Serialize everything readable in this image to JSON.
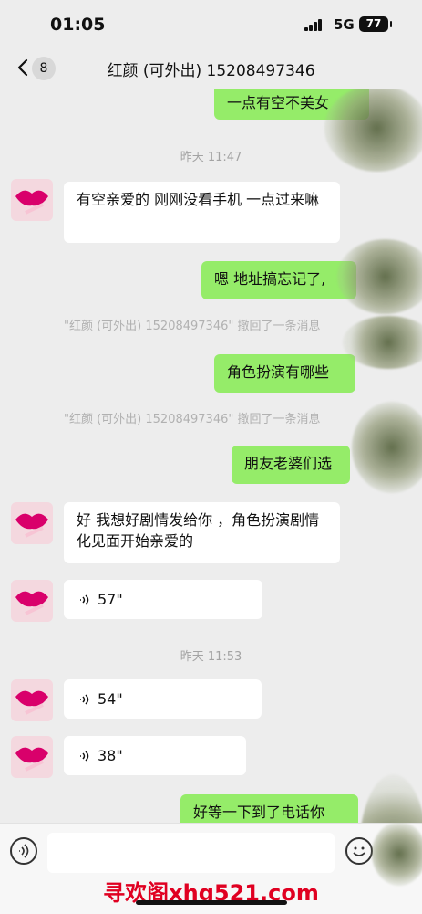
{
  "status_bar": {
    "time": "01:05",
    "network": "5G",
    "battery": "77"
  },
  "header": {
    "unread": "8",
    "title": "红颜 (可外出) 15208497346"
  },
  "messages": {
    "m1": "一点有空不美女",
    "t1": "昨天 11:47",
    "m2": "有空亲爱的  刚刚没看手机 一点过来嘛",
    "m3": "嗯 地址搞忘记了,",
    "s1": "\"红颜 (可外出) 15208497346\" 撤回了一条消息",
    "m4": "角色扮演有哪些",
    "s2": "\"红颜 (可外出) 15208497346\" 撤回了一条消息",
    "m5": "朋友老婆们选",
    "m6": "好 我想好剧情发给你 ，角色扮演剧情化见面开始亲爱的",
    "v1": "57\"",
    "t2": "昨天 11:53",
    "v2": "54\"",
    "v3": "38\"",
    "m7": "好等一下到了电话你"
  },
  "watermark": "寻欢阁xhg521.com"
}
